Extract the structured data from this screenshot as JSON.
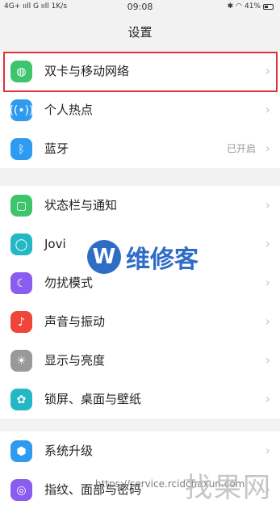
{
  "status_bar": {
    "left": "4G+ ııll G ııll 1K/s",
    "time": "09:08",
    "battery": "41%",
    "bluetooth_icon": "bluetooth-icon",
    "wifi_icon": "wifi-icon"
  },
  "header": {
    "title": "设置"
  },
  "groups": [
    {
      "items": [
        {
          "label": "双卡与移动网络",
          "icon": "globe-icon",
          "color": "#3ec46d"
        },
        {
          "label": "个人热点",
          "icon": "hotspot-icon",
          "color": "#2f9bf0"
        },
        {
          "label": "蓝牙",
          "icon": "bluetooth-icon",
          "color": "#2f9bf0",
          "value": "已开启"
        }
      ]
    },
    {
      "items": [
        {
          "label": "状态栏与通知",
          "icon": "notification-icon",
          "color": "#3ec46d"
        },
        {
          "label": "Jovi",
          "icon": "jovi-icon",
          "color": "#23b8c4"
        },
        {
          "label": "勿扰模式",
          "icon": "moon-icon",
          "color": "#8b5cf0"
        },
        {
          "label": "声音与振动",
          "icon": "sound-icon",
          "color": "#f0453a"
        },
        {
          "label": "显示与亮度",
          "icon": "brightness-icon",
          "color": "#999999"
        },
        {
          "label": "锁屏、桌面与壁纸",
          "icon": "palette-icon",
          "color": "#23b8c4"
        }
      ]
    },
    {
      "items": [
        {
          "label": "系统升级",
          "icon": "update-icon",
          "color": "#2f9bf0"
        },
        {
          "label": "指纹、面部与密码",
          "icon": "fingerprint-icon",
          "color": "#8b5cf0"
        }
      ]
    }
  ],
  "watermarks": {
    "brand_letter": "W",
    "brand_text": "维修客",
    "url": "https://service.rcidchaxun.com",
    "corner": "找果网"
  }
}
